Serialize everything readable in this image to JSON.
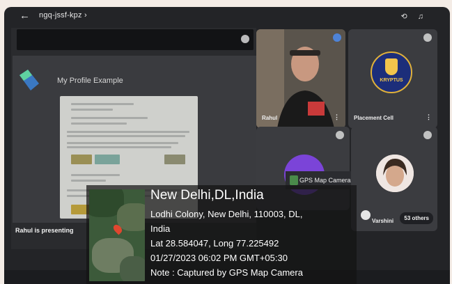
{
  "topbar": {
    "back_icon": "arrow-left-icon",
    "meeting_code": "ngq-jssf-kpz ›",
    "icons": [
      "switch-camera-icon",
      "audio-output-icon"
    ]
  },
  "presentation": {
    "slide_title": "My Profile Example",
    "presenting_text": "Rahul is presenting"
  },
  "participants": [
    {
      "name": "Rahul"
    },
    {
      "name": "Placement Cell",
      "logo_text": "KRYPTUS"
    },
    {
      "name": "GPS Map Camera"
    },
    {
      "name": "Varshini"
    }
  ],
  "others_count": "53 others",
  "gps_overlay": {
    "city": "New Delhi,DL,India",
    "address_1": "Lodhi Colony, New Delhi, 110003, DL,",
    "address_2": "India",
    "coords": "Lat 28.584047, Long 77.225492",
    "datetime": "01/27/2023 06:02 PM GMT+05:30",
    "note": "Note : Captured by GPS Map Camera"
  },
  "colors": {
    "accent_purple": "#7b44d8",
    "pin_red": "#e0462f",
    "tile_bg": "#3b3c40"
  }
}
